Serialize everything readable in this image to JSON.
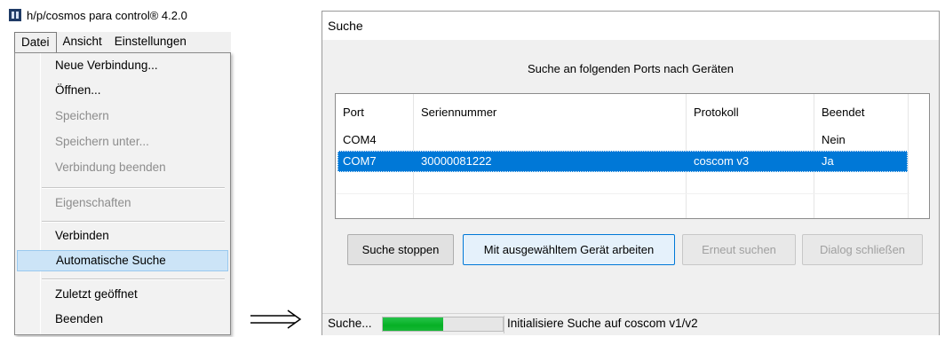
{
  "app": {
    "title": "h/p/cosmos para control® 4.2.0"
  },
  "menubar": {
    "items": [
      "Datei",
      "Ansicht",
      "Einstellungen"
    ]
  },
  "file_menu": {
    "items": [
      {
        "label": "Neue Verbindung...",
        "enabled": true
      },
      {
        "label": "Öffnen...",
        "enabled": true
      },
      {
        "label": "Speichern",
        "enabled": false
      },
      {
        "label": "Speichern unter...",
        "enabled": false
      },
      {
        "label": "Verbindung beenden",
        "enabled": false
      },
      {
        "label": "Eigenschaften",
        "enabled": false
      },
      {
        "label": "Verbinden",
        "enabled": true
      },
      {
        "label": "Automatische Suche",
        "enabled": true,
        "highlighted": true
      },
      {
        "label": "Zuletzt geöffnet",
        "enabled": true
      },
      {
        "label": "Beenden",
        "enabled": true
      }
    ]
  },
  "arrow_icon": "long-right-arrow-icon",
  "dialog": {
    "title": "Suche",
    "heading": "Suche an folgenden Ports nach Geräten",
    "table": {
      "columns": [
        "Port",
        "Seriennummer",
        "Protokoll",
        "Beendet"
      ],
      "rows": [
        {
          "port": "COM4",
          "serial": "",
          "protocol": "",
          "done": "Nein",
          "selected": false
        },
        {
          "port": "COM7",
          "serial": "30000081222",
          "protocol": "coscom v3",
          "done": "Ja",
          "selected": true
        }
      ]
    },
    "buttons": {
      "stop": "Suche stoppen",
      "work": "Mit ausgewähltem Gerät arbeiten",
      "retry": "Erneut suchen",
      "close": "Dialog schließen"
    },
    "status": {
      "label": "Suche...",
      "progress_percent": 50,
      "message": "Initialisiere Suche auf coscom v1/v2"
    }
  },
  "colors": {
    "selection": "#0078d7",
    "menu_highlight": "#cce4f7",
    "progress": "#06b025"
  }
}
